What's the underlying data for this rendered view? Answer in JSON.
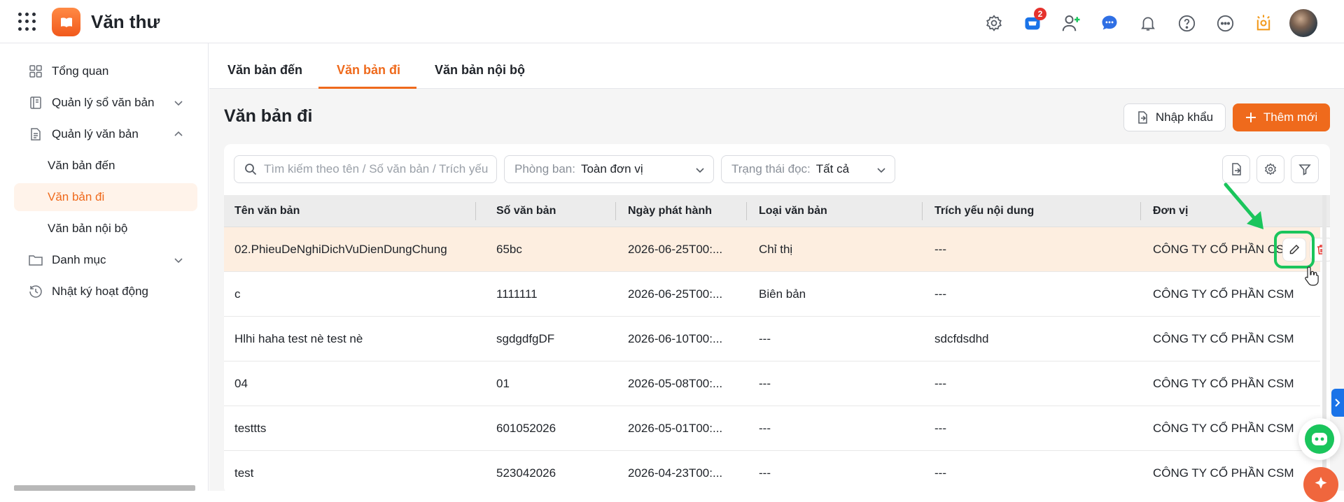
{
  "app": {
    "title": "Văn thư"
  },
  "topbar": {
    "cart_badge": "2"
  },
  "sidebar": {
    "items": [
      {
        "label": "Tổng quan"
      },
      {
        "label": "Quản lý sổ văn bản"
      },
      {
        "label": "Quản lý văn bản"
      },
      {
        "label": "Văn bản đến"
      },
      {
        "label": "Văn bản đi"
      },
      {
        "label": "Văn bản nội bộ"
      },
      {
        "label": "Danh mục"
      },
      {
        "label": "Nhật ký hoạt động"
      }
    ]
  },
  "tabs": [
    {
      "label": "Văn bản đến"
    },
    {
      "label": "Văn bản đi"
    },
    {
      "label": "Văn bản nội bộ"
    }
  ],
  "page": {
    "title": "Văn bản đi",
    "import_label": "Nhập khẩu",
    "new_label": "Thêm mới"
  },
  "filters": {
    "search_placeholder": "Tìm kiếm theo tên / Số văn bản / Trích yếu",
    "department_label": "Phòng ban:",
    "department_value": "Toàn đơn vị",
    "status_label": "Trạng thái đọc:",
    "status_value": "Tất cả"
  },
  "table": {
    "headers": [
      "Tên văn bản",
      "Số văn bản",
      "Ngày phát hành",
      "Loại văn bản",
      "Trích yếu nội dung",
      "Đơn vị"
    ],
    "rows": [
      {
        "name": "02.PhieuDeNghiDichVuDienDungChung",
        "number": "65bc",
        "date": "2026-06-25T00:...",
        "type": "Chỉ thị",
        "summary": "---",
        "unit": "CÔNG TY CỔ PHẦN CSM"
      },
      {
        "name": "c",
        "number": "1111111",
        "date": "2026-06-25T00:...",
        "type": "Biên bản",
        "summary": "---",
        "unit": "CÔNG TY CỔ PHẦN CSM"
      },
      {
        "name": "Hlhi haha test nè test nè",
        "number": "sgdgdfgDF",
        "date": "2026-06-10T00:...",
        "type": "---",
        "summary": "sdcfdsdhd",
        "unit": "CÔNG TY CỔ PHẦN CSM"
      },
      {
        "name": "04",
        "number": "01",
        "date": "2026-05-08T00:...",
        "type": "---",
        "summary": "---",
        "unit": "CÔNG TY CỔ PHẦN CSM"
      },
      {
        "name": "testtts",
        "number": "601052026",
        "date": "2026-05-01T00:...",
        "type": "---",
        "summary": "---",
        "unit": "CÔNG TY CỔ PHẦN CSM"
      },
      {
        "name": "test",
        "number": "523042026",
        "date": "2026-04-23T00:...",
        "type": "---",
        "summary": "---",
        "unit": "CÔNG TY CỔ PHẦN CSM"
      }
    ]
  },
  "colors": {
    "accent": "#ef6a1c",
    "highlight": "#1ac55c",
    "row_highlight": "#fdeee0"
  }
}
